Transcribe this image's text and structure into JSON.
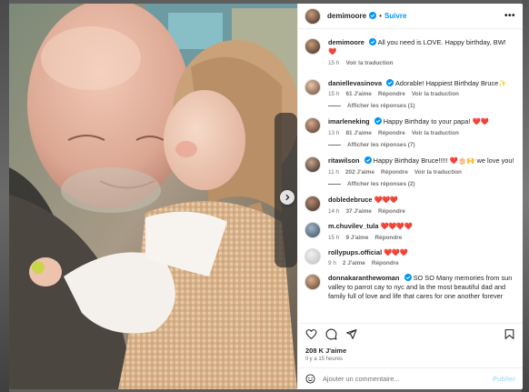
{
  "header": {
    "username": "demimoore",
    "separator": "•",
    "follow_label": "Suivre",
    "more_label": "•••"
  },
  "caption": {
    "username": "demimoore",
    "text": "All you need is LOVE. Happy birthday, BW! ❤️",
    "time": "15 h",
    "translate": "Voir la traduction"
  },
  "comments": [
    {
      "username": "daniellevasinova",
      "text": "Adorable! Happiest Birthday Bruce✨",
      "time": "15 h",
      "likes": "61 J'aime",
      "reply": "Répondre",
      "translate": "Voir la traduction",
      "view_replies": "Afficher les réponses (1)"
    },
    {
      "username": "imarleneking",
      "text": "Happy Birthday to your papa! ❤️❤️",
      "time": "13 h",
      "likes": "81 J'aime",
      "reply": "Répondre",
      "translate": "Voir la traduction",
      "view_replies": "Afficher les réponses (7)"
    },
    {
      "username": "ritawilson",
      "text": "Happy Birthday Bruce!!!!! ❤️🎂🙌 we love you!",
      "time": "11 h",
      "likes": "202 J'aime",
      "reply": "Répondre",
      "translate": "Voir la traduction",
      "view_replies": "Afficher les réponses (2)"
    },
    {
      "username": "dobledebruce",
      "text": "❤️❤️❤️",
      "time": "14 h",
      "likes": "37 J'aime",
      "reply": "Répondre"
    },
    {
      "username": "m.chuvilev_tula",
      "text": "❤️❤️❤️❤️",
      "time": "15 h",
      "likes": "9 J'aime",
      "reply": "Répondre"
    },
    {
      "username": "rollypups.official",
      "text": "❤️❤️❤️",
      "time": "9 h",
      "likes": "2 J'aime",
      "reply": "Répondre"
    },
    {
      "username": "donnakaranthewoman",
      "text": "SO SO Many memories from sun valley to parrot cay to nyc and la the most beautiful dad and family full of love and life that cares for one another forever"
    }
  ],
  "footer": {
    "likes": "208 K J'aime",
    "time_ago": "Il y a 15 heures",
    "comment_placeholder": "Ajouter un commentaire...",
    "post_label": "Publier"
  },
  "icons": {
    "like": "heart-icon",
    "comment": "comment-icon",
    "share": "share-icon",
    "save": "bookmark-icon",
    "emoji": "emoji-icon",
    "next": "chevron-right-icon",
    "verified": "verified-badge-icon"
  },
  "colors": {
    "accent": "#0095f6",
    "verified": "#0095f6",
    "muted": "#737373",
    "post_disabled": "#b2dffc"
  }
}
